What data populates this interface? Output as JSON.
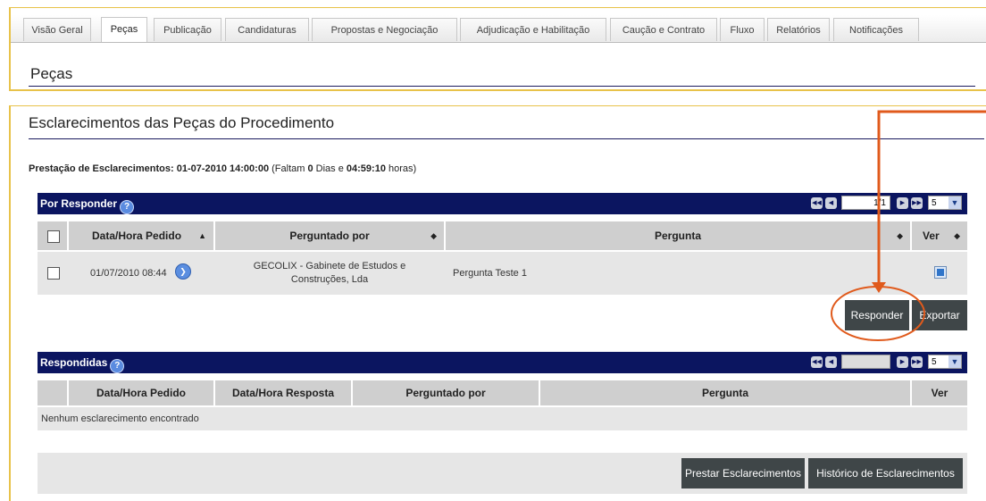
{
  "tabs": [
    {
      "label": "Visão Geral"
    },
    {
      "label": "Peças"
    },
    {
      "label": "Publicação"
    },
    {
      "label": "Candidaturas"
    },
    {
      "label": "Propostas e Negociação"
    },
    {
      "label": "Adjudicação e Habilitação"
    },
    {
      "label": "Caução e Contrato"
    },
    {
      "label": "Fluxo"
    },
    {
      "label": "Relatórios"
    },
    {
      "label": "Notificações"
    }
  ],
  "section_title": "Peças",
  "subtitle": "Esclarecimentos das Peças do Procedimento",
  "deadline": {
    "label": "Prestação de Esclarecimentos:",
    "datetime": "01-07-2010 14:00:00",
    "faltam": "(Faltam",
    "days": "0",
    "days_label": "Dias e",
    "time": "04:59:10",
    "hours_label": "horas)"
  },
  "por_responder": {
    "title": "Por Responder",
    "page_value": "1/1",
    "page_size": "5",
    "columns": [
      "Data/Hora Pedido",
      "Perguntado por",
      "Pergunta",
      "Ver"
    ],
    "rows": [
      {
        "date": "01/07/2010 08:44",
        "asked_by_line1": "GECOLIX - Gabinete de Estudos e",
        "asked_by_line2": "Construções, Lda",
        "question": "Pergunta Teste 1"
      }
    ],
    "buttons": {
      "respond": "Responder",
      "export": "Exportar"
    }
  },
  "respondidas": {
    "title": "Respondidas",
    "page_value": "",
    "page_size": "5",
    "columns": [
      "Data/Hora Pedido",
      "Data/Hora Resposta",
      "Perguntado por",
      "Pergunta",
      "Ver"
    ],
    "empty_message": "Nenhum esclarecimento encontrado"
  },
  "footer_buttons": {
    "provide": "Prestar Esclarecimentos",
    "history": "Histórico de Esclarecimentos"
  },
  "colors": {
    "header_bar": "#0b1560",
    "frame": "#e8c24a",
    "annotation": "#e05a1c",
    "button": "#3f4648"
  }
}
